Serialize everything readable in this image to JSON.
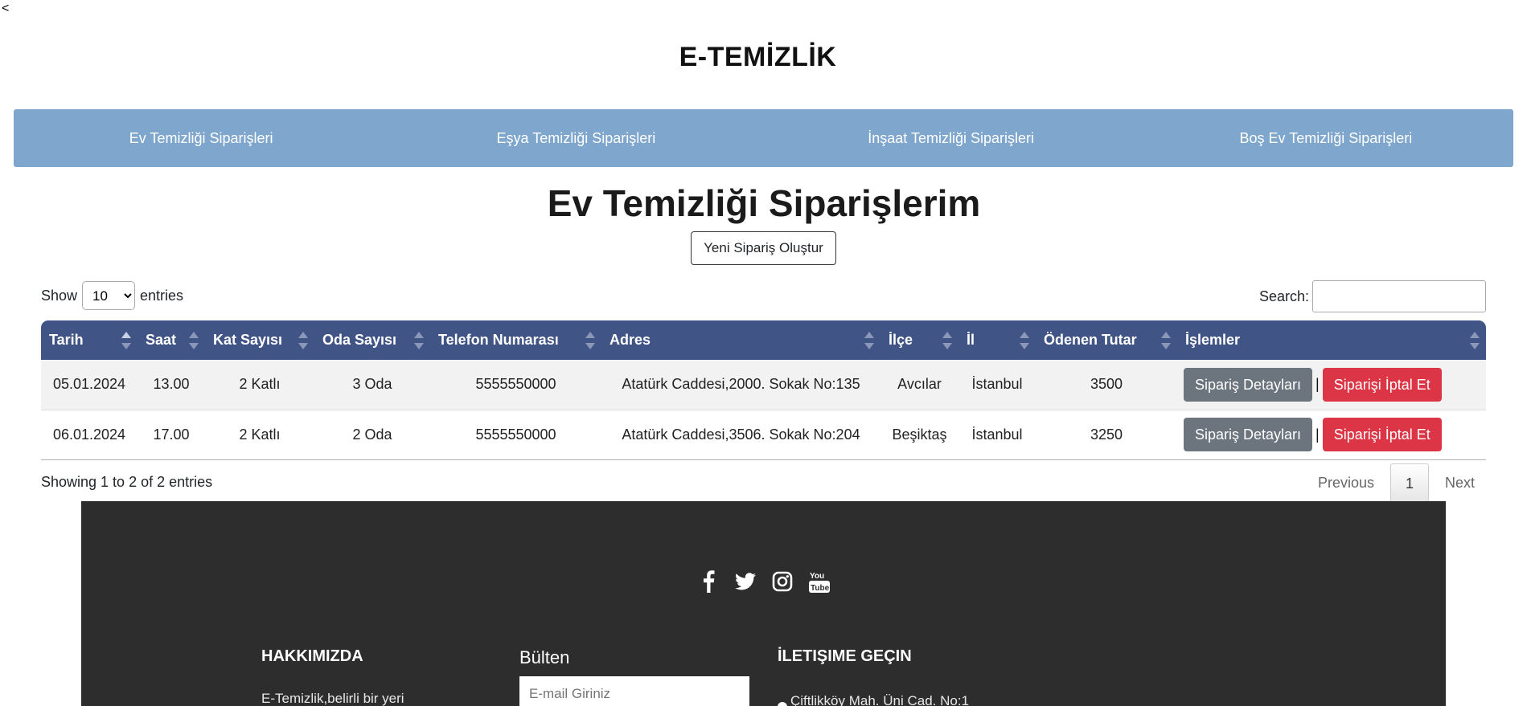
{
  "back": "<",
  "site_title": "E-TEMİZLİK",
  "nav": [
    {
      "label": "Ev Temizliği Siparişleri"
    },
    {
      "label": "Eşya Temizliği Siparişleri"
    },
    {
      "label": "İnşaat Temizliği Siparişleri"
    },
    {
      "label": "Boş Ev Temizliği Siparişleri"
    }
  ],
  "heading": "Ev Temizliği Siparişlerim",
  "new_order_button": "Yeni Sipariş Oluştur",
  "length": {
    "show": "Show",
    "value": "10",
    "entries": "entries"
  },
  "search": {
    "label": "Search:",
    "placeholder": ""
  },
  "table": {
    "columns": [
      "Tarih",
      "Saat",
      "Kat Sayısı",
      "Oda Sayısı",
      "Telefon Numarası",
      "Adres",
      "İlçe",
      "İl",
      "Ödenen Tutar",
      "İşlemler"
    ],
    "rows": [
      {
        "tarih": "05.01.2024",
        "saat": "13.00",
        "kat": "2 Katlı",
        "oda": "3 Oda",
        "telefon": "5555550000",
        "adres": "Atatürk Caddesi,2000. Sokak No:135",
        "ilce": "Avcılar",
        "il": "İstanbul",
        "tutar": "3500"
      },
      {
        "tarih": "06.01.2024",
        "saat": "17.00",
        "kat": "2 Katlı",
        "oda": "2 Oda",
        "telefon": "5555550000",
        "adres": "Atatürk Caddesi,3506. Sokak No:204",
        "ilce": "Beşiktaş",
        "il": "İstanbul",
        "tutar": "3250"
      }
    ],
    "detail_button": "Sipariş Detayları",
    "separator": "|",
    "cancel_button": "Siparişi İptal Et"
  },
  "info": "Showing 1 to 2 of 2 entries",
  "pager": {
    "previous": "Previous",
    "current": "1",
    "next": "Next"
  },
  "footer": {
    "social_icons": [
      "facebook-icon",
      "twitter-icon",
      "instagram-icon",
      "youtube-icon"
    ],
    "about_title": "HAKKIMIZDA",
    "about_text": "E-Temizlik,belirli bir yeri",
    "newsletter_title": "Bülten",
    "email_placeholder": "E-mail Giriniz",
    "contact_title": "İLETIŞIME GEÇIN",
    "contact_address": "Çiftlikköy Mah. Üni Cad. No:1"
  }
}
